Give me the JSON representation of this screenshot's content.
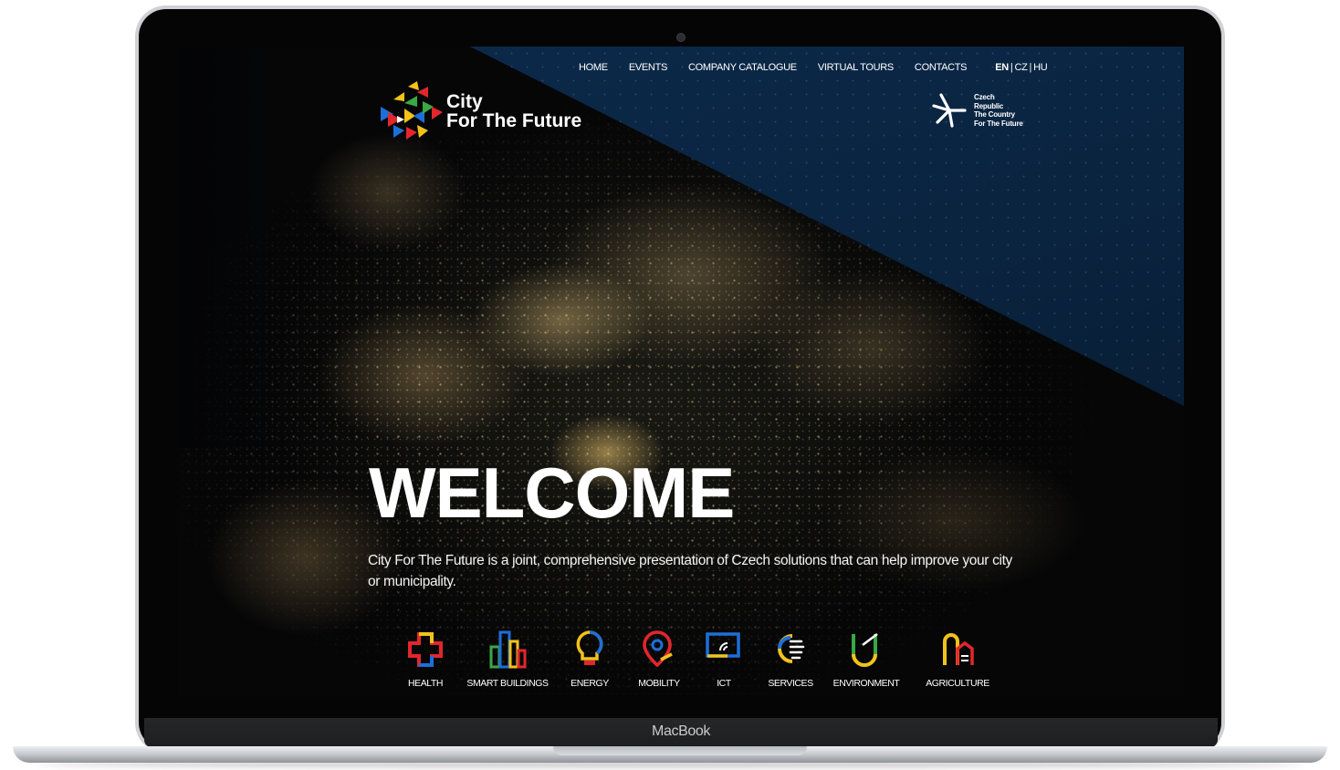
{
  "device": {
    "label": "MacBook"
  },
  "site": {
    "logo": {
      "line1": "City",
      "line2": "For The Future",
      "icon": "city-for-the-future-logo-icon"
    },
    "nav": {
      "items": [
        {
          "label": "HOME"
        },
        {
          "label": "EVENTS"
        },
        {
          "label": "COMPANY CATALOGUE"
        },
        {
          "label": "VIRTUAL TOURS"
        },
        {
          "label": "CONTACTS"
        }
      ],
      "languages": [
        "EN",
        "CZ",
        "HU"
      ],
      "active_language": "EN"
    },
    "badge": {
      "icon": "czech-republic-star-icon",
      "lines": [
        "Czech",
        "Republic",
        "The Country",
        "For The Future"
      ]
    },
    "hero": {
      "heading": "WELCOME",
      "intro": "City For The Future is a joint, comprehensive presentation of Czech solutions that can help improve your city or municipality."
    },
    "categories": [
      {
        "label": "HEALTH",
        "icon": "health-cross-icon"
      },
      {
        "label": "SMART BUILDINGS",
        "icon": "smart-buildings-icon"
      },
      {
        "label": "ENERGY",
        "icon": "energy-bulb-icon"
      },
      {
        "label": "MOBILITY",
        "icon": "mobility-pin-icon"
      },
      {
        "label": "ICT",
        "icon": "ict-screen-icon"
      },
      {
        "label": "SERVICES",
        "icon": "services-hand-icon"
      },
      {
        "label": "ENVIRONMENT",
        "icon": "environment-leaf-icon"
      },
      {
        "label": "AGRICULTURE",
        "icon": "agriculture-silo-icon"
      }
    ],
    "colors": {
      "yellow": "#f2c21b",
      "red": "#e3262d",
      "blue": "#1d6fd8",
      "green": "#39a845",
      "panel_blue": "#0c2a4c"
    }
  }
}
